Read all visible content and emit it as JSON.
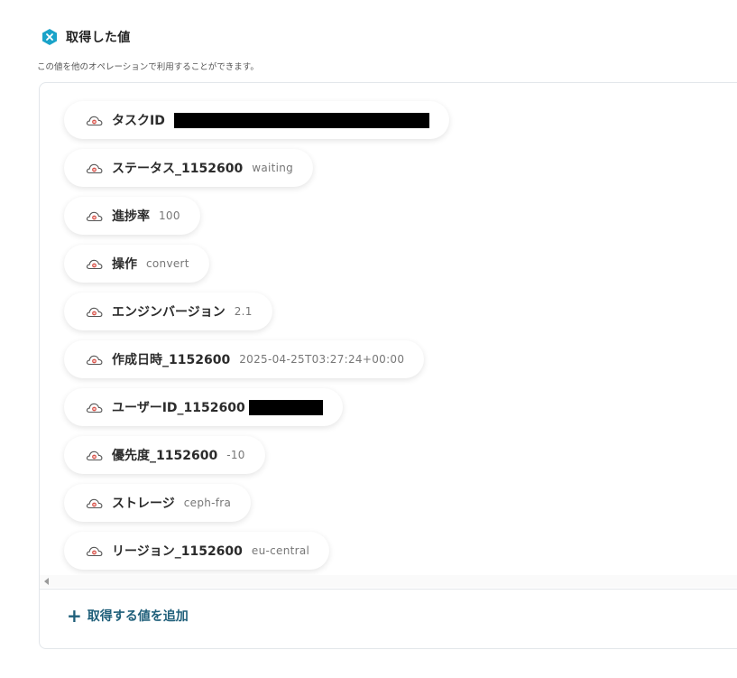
{
  "header": {
    "title": "取得した値",
    "subtitle": "この値を他のオペレーションで利用することができます。"
  },
  "colors": {
    "accent": "#1aa3c9",
    "link": "#1f5f7a",
    "cloud_icon": "#d9564d"
  },
  "icons": {
    "badge": "x-close-icon",
    "item": "cloud-icon",
    "add": "plus-icon",
    "scroll": "scroll-left-arrow-icon"
  },
  "items": [
    {
      "label": "タスクID",
      "value": "",
      "redacted": true
    },
    {
      "label": "ステータス_1152600",
      "value": "waiting"
    },
    {
      "label": "進捗率",
      "value": "100"
    },
    {
      "label": "操作",
      "value": "convert"
    },
    {
      "label": "エンジンバージョン",
      "value": "2.1"
    },
    {
      "label": "作成日時_1152600",
      "value": "2025-04-25T03:27:24+00:00"
    },
    {
      "label": "ユーザーID_1152600",
      "value": "",
      "redacted": true
    },
    {
      "label": "優先度_1152600",
      "value": "-10"
    },
    {
      "label": "ストレージ",
      "value": "ceph-fra"
    },
    {
      "label": "リージョン_1152600",
      "value": "eu-central"
    }
  ],
  "add_button": {
    "label": "取得する値を追加"
  }
}
